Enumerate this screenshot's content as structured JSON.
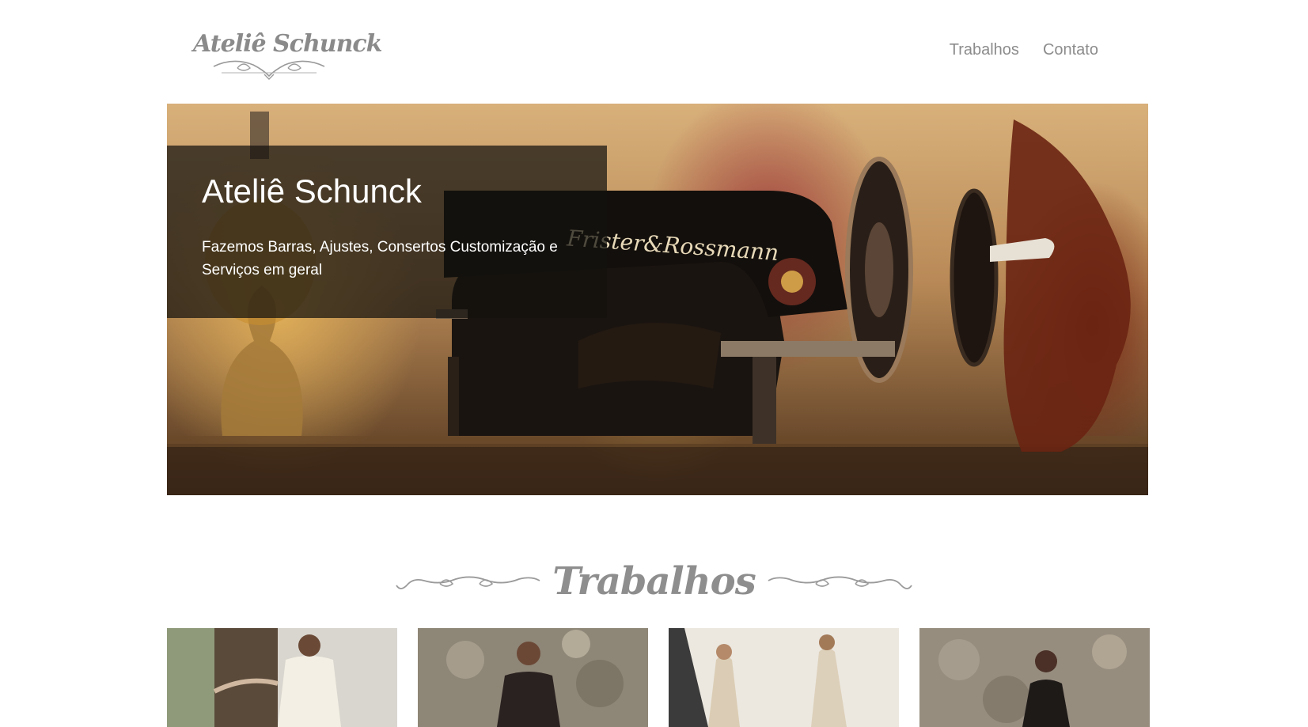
{
  "brand": {
    "logo_text": "Ateliê Schunck"
  },
  "nav": {
    "items": [
      {
        "label": "Trabalhos"
      },
      {
        "label": "Contato"
      }
    ]
  },
  "hero": {
    "title": "Ateliê Schunck",
    "subtitle": "Fazemos Barras, Ajustes, Consertos Customização e Serviços em geral",
    "machine_brand": "Frister&Rossmann"
  },
  "works": {
    "title": "Trabalhos"
  },
  "gallery": {
    "items": [
      {
        "name": "work-photo-white-dress"
      },
      {
        "name": "work-photo-lace-top"
      },
      {
        "name": "work-photo-sketches"
      },
      {
        "name": "work-photo-stone-wall"
      }
    ]
  },
  "colors": {
    "text_gray": "#8c8c8c",
    "overlay": "#14120e",
    "white": "#ffffff"
  }
}
